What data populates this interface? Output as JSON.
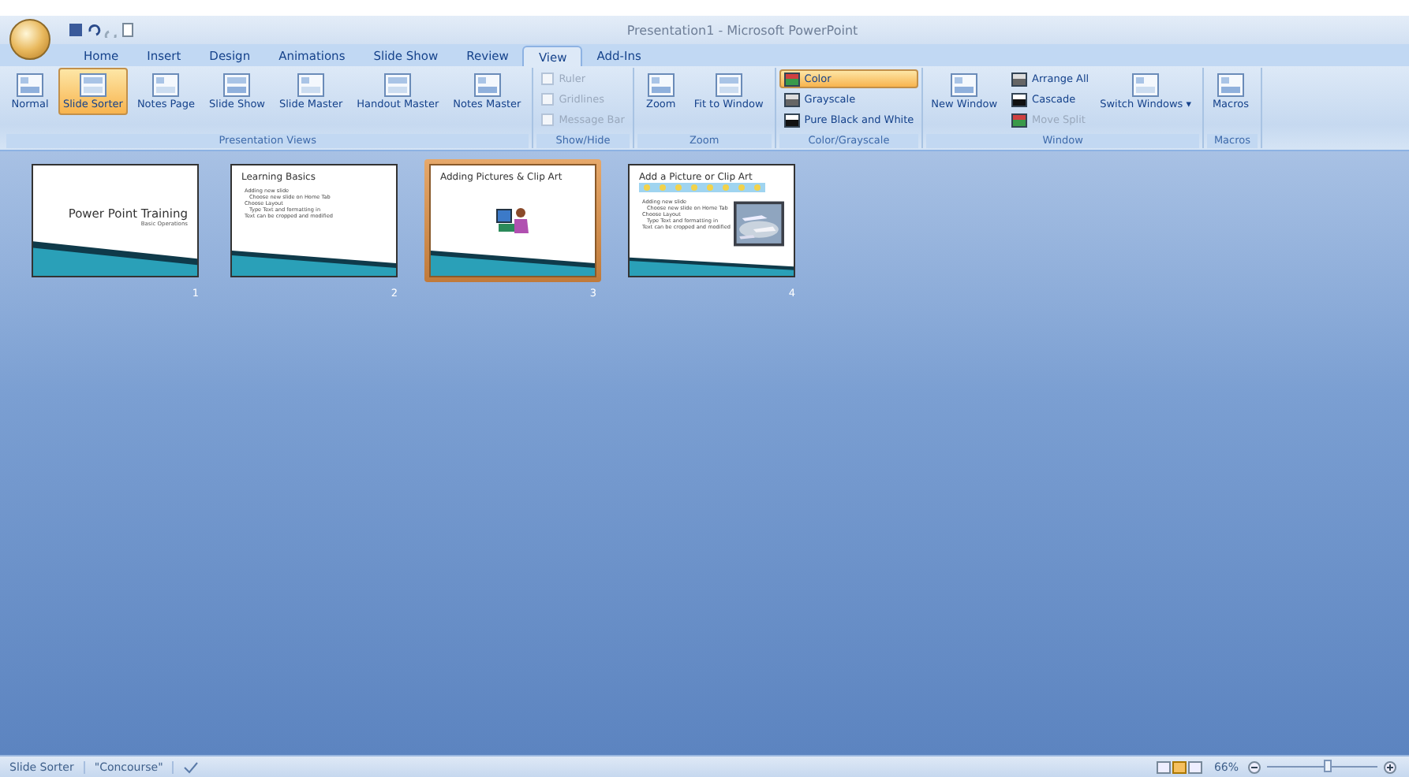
{
  "window": {
    "title": "Presentation1 - Microsoft PowerPoint"
  },
  "tabs": [
    {
      "label": "Home",
      "selected": false
    },
    {
      "label": "Insert",
      "selected": false
    },
    {
      "label": "Design",
      "selected": false
    },
    {
      "label": "Animations",
      "selected": false
    },
    {
      "label": "Slide Show",
      "selected": false
    },
    {
      "label": "Review",
      "selected": false
    },
    {
      "label": "View",
      "selected": true
    },
    {
      "label": "Add-Ins",
      "selected": false
    }
  ],
  "ribbon": [
    {
      "label": "Presentation Views",
      "items": [
        {
          "kind": "large",
          "label": "Normal",
          "selected": false
        },
        {
          "kind": "large",
          "label": "Slide Sorter",
          "selected": true
        },
        {
          "kind": "large",
          "label": "Notes Page",
          "selected": false
        },
        {
          "kind": "large",
          "label": "Slide Show",
          "selected": false
        },
        {
          "kind": "large",
          "label": "Slide Master",
          "selected": false
        },
        {
          "kind": "large",
          "label": "Handout Master",
          "selected": false
        },
        {
          "kind": "large",
          "label": "Notes Master",
          "selected": false
        }
      ]
    },
    {
      "label": "Show/Hide",
      "items": [
        {
          "kind": "check",
          "label": "Ruler",
          "disabled": true
        },
        {
          "kind": "check",
          "label": "Gridlines",
          "disabled": true
        },
        {
          "kind": "check",
          "label": "Message Bar",
          "disabled": true
        }
      ]
    },
    {
      "label": "Zoom",
      "items": [
        {
          "kind": "large",
          "label": "Zoom",
          "selected": false
        },
        {
          "kind": "large",
          "label": "Fit to Window",
          "selected": false
        }
      ]
    },
    {
      "label": "Color/Grayscale",
      "items": [
        {
          "kind": "small",
          "label": "Color",
          "selected": true
        },
        {
          "kind": "small",
          "label": "Grayscale",
          "selected": false
        },
        {
          "kind": "small",
          "label": "Pure Black and White",
          "selected": false
        }
      ]
    },
    {
      "label": "Window",
      "items": [
        {
          "kind": "large",
          "label": "New Window",
          "selected": false
        },
        {
          "kind": "small",
          "label": "Arrange All",
          "disabled": false
        },
        {
          "kind": "small",
          "label": "Cascade",
          "disabled": false
        },
        {
          "kind": "small",
          "label": "Move Split",
          "disabled": true
        },
        {
          "kind": "large",
          "label": "Switch Windows ▾",
          "selected": false
        }
      ]
    },
    {
      "label": "Macros",
      "items": [
        {
          "kind": "large",
          "label": "Macros",
          "selected": false
        }
      ]
    }
  ],
  "slides": [
    {
      "number": "1",
      "title": "Power Point Training",
      "subtitle": "Basic Operations",
      "kind": "title",
      "selected": false
    },
    {
      "number": "2",
      "title": "Learning Basics",
      "bullets": [
        "Adding new slide",
        "Choose new slide on Home Tab",
        "Choose Layout",
        "Type Text and formatting in",
        "Text can be cropped and modified"
      ],
      "kind": "bullets",
      "selected": false
    },
    {
      "number": "3",
      "title": "Adding Pictures & Clip Art",
      "kind": "clipart",
      "selected": true
    },
    {
      "number": "4",
      "title": "Add a Picture or Clip Art",
      "bullets": [
        "Adding new slide",
        "Choose new slide on Home Tab",
        "Choose Layout",
        "Type Text and formatting in",
        "Text can be cropped and modified"
      ],
      "selected": false
    }
  ],
  "status_bar": {
    "view": "Slide Sorter",
    "theme": "\"Concourse\"",
    "zoom": "66%",
    "zoom_slider": {
      "level": 0.55
    }
  }
}
